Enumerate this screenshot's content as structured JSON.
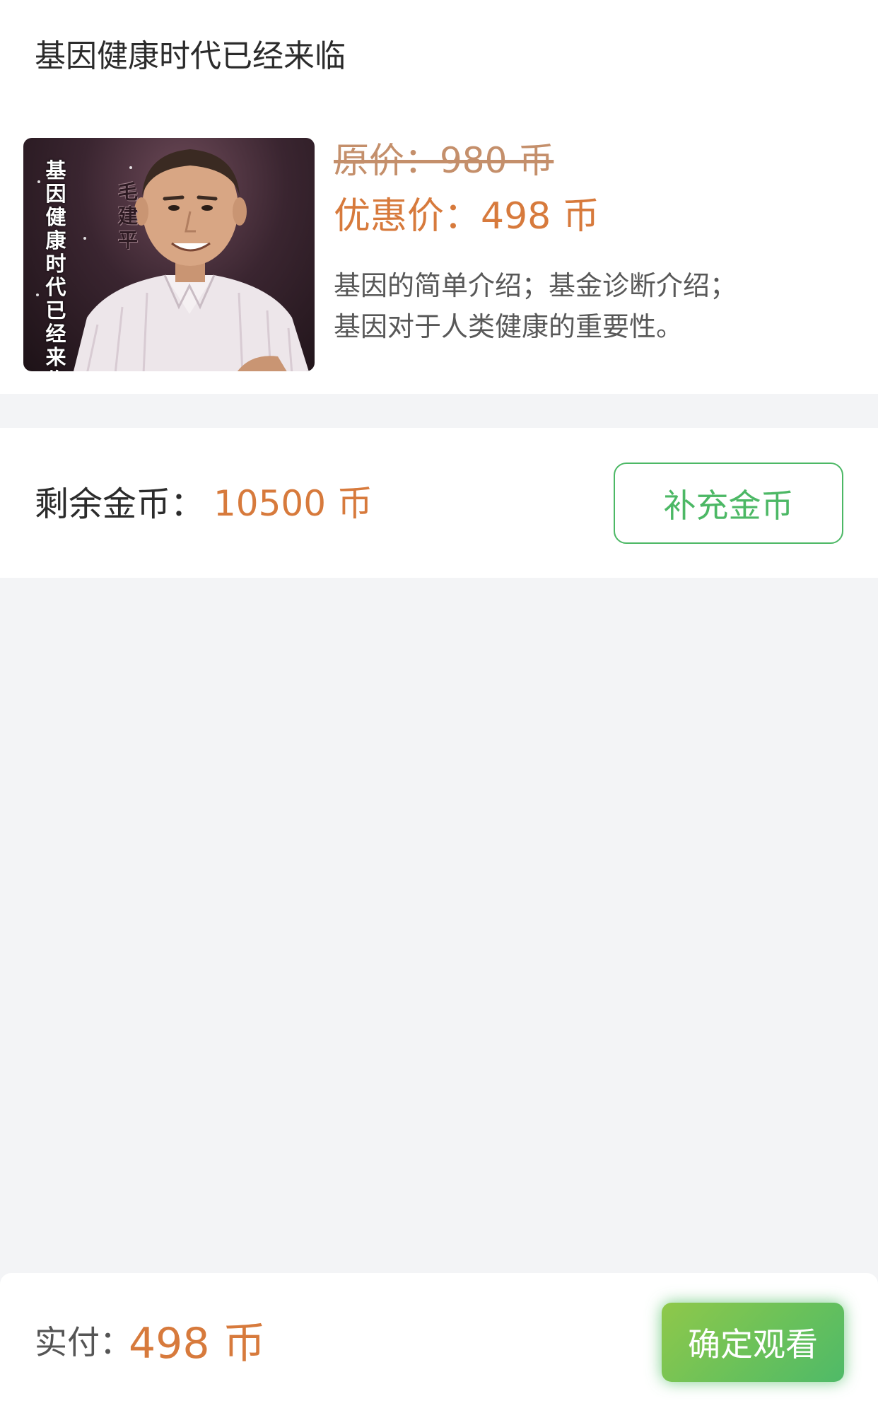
{
  "course": {
    "title": "基因健康时代已经来临",
    "cover_title": "基因健康时代已经来临",
    "cover_name": "毛建平",
    "original_price": "原价：980 币",
    "discount_price": "优惠价：498 币",
    "description_line1": "基因的简单介绍；基金诊断介绍；",
    "description_line2": "基因对于人类健康的重要性。"
  },
  "balance": {
    "label": "剩余金币：",
    "value": "10500 币",
    "recharge_label": "补充金币"
  },
  "payment": {
    "label": "实付：",
    "value": "498 币",
    "confirm_label": "确定观看"
  },
  "colors": {
    "accent_orange": "#d77a3c",
    "accent_green": "#4cb865",
    "background": "#f3f4f6"
  }
}
